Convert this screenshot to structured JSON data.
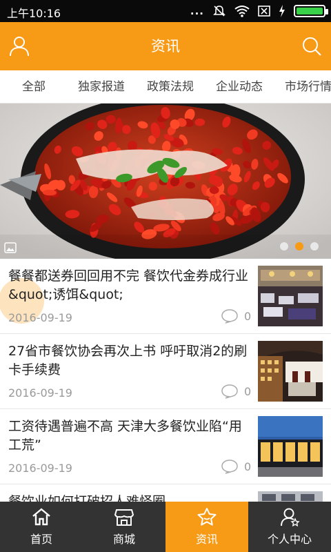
{
  "status_bar": {
    "time": "上午10:16",
    "signal": "...",
    "icons": [
      "mute-icon",
      "wifi-icon",
      "sim-icon",
      "charging-icon",
      "battery-icon"
    ],
    "battery_percent": 95
  },
  "header": {
    "title": "资讯",
    "left_icon": "user-icon",
    "right_icon": "search-icon",
    "color": "#f79a16"
  },
  "tabs": [
    "全部",
    "独家报道",
    "政策法规",
    "企业动态",
    "市场行情"
  ],
  "banner": {
    "slides": 3,
    "active_slide": 2,
    "image": "spicy-fish-dish"
  },
  "news": [
    {
      "headline": "餐餐都送券回回用不完 餐饮代金券成行业&quot;诱饵&quot;",
      "date": "2016-09-19",
      "comments": "0",
      "thumb": "restaurant-dining-hall"
    },
    {
      "headline": "27省市餐饮协会再次上书 呼吁取消2的刷卡手续费",
      "date": "2016-09-19",
      "comments": "0",
      "thumb": "restaurant-interior"
    },
    {
      "headline": "工资待遇普遍不高 天津大多餐饮业陷“用工荒”",
      "date": "2016-09-19",
      "comments": "0",
      "thumb": "restaurant-night-front"
    },
    {
      "headline": "餐饮业如何打破招人难怪圈",
      "date": "",
      "comments": "",
      "thumb": "restaurant-interior-2"
    }
  ],
  "bottom_nav": [
    {
      "label": "首页",
      "icon": "home-icon",
      "active": false
    },
    {
      "label": "商城",
      "icon": "shop-icon",
      "active": false
    },
    {
      "label": "资讯",
      "icon": "star-icon",
      "active": true
    },
    {
      "label": "个人中心",
      "icon": "profile-icon",
      "active": false
    }
  ]
}
